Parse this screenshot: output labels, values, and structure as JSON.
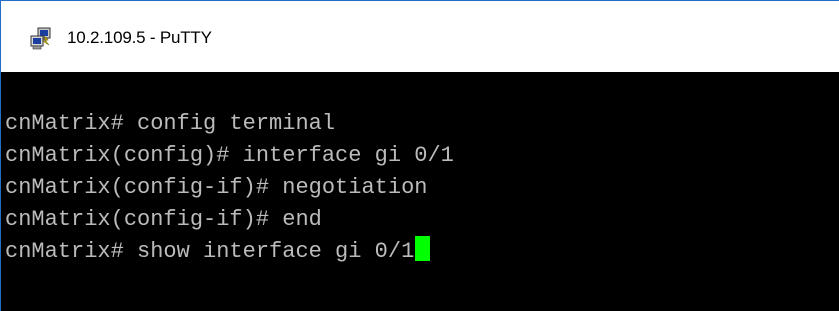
{
  "window": {
    "title": "10.2.109.5 - PuTTY",
    "title_icon": "putty-icon"
  },
  "terminal": {
    "lines": [
      "cnMatrix# config terminal",
      "cnMatrix(config)# interface gi 0/1",
      "cnMatrix(config-if)# negotiation",
      "cnMatrix(config-if)# end",
      "cnMatrix# show interface gi 0/1"
    ],
    "foreground_color": "#bbbbbb",
    "background_color": "#000000",
    "cursor_color": "#00ff00"
  }
}
